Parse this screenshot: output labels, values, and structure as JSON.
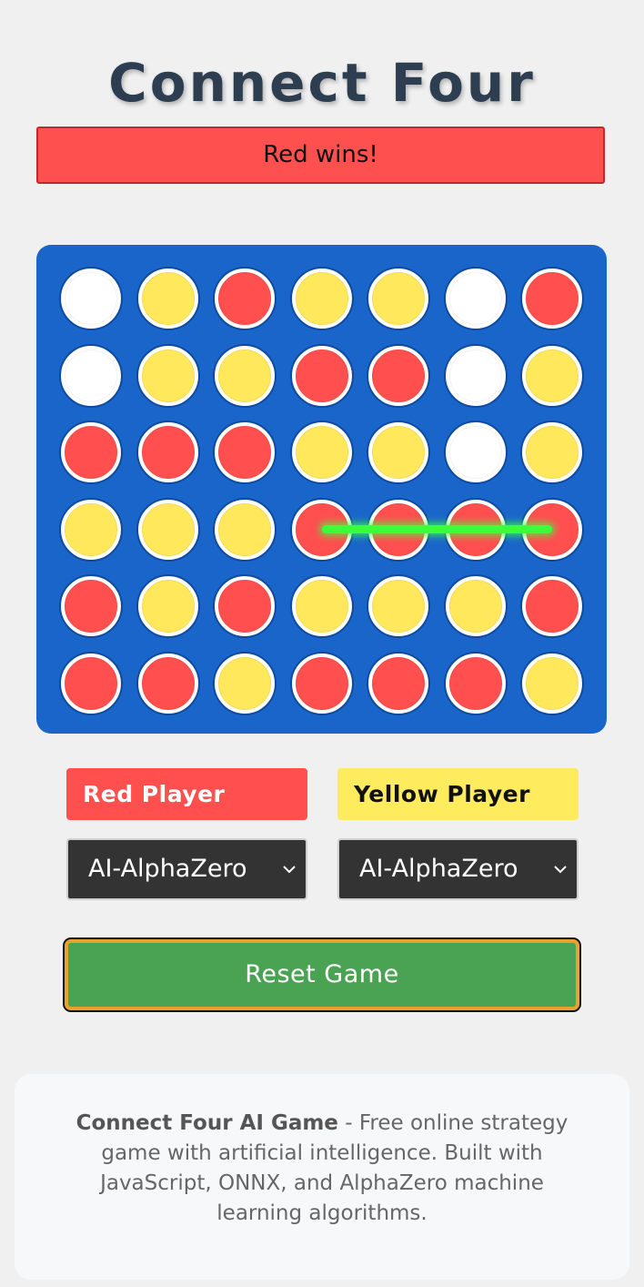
{
  "title": "Connect Four",
  "status": "Red wins!",
  "board": {
    "rows": [
      [
        "empty",
        "yellow",
        "red",
        "yellow",
        "yellow",
        "empty",
        "red"
      ],
      [
        "empty",
        "yellow",
        "yellow",
        "red",
        "red",
        "empty",
        "yellow"
      ],
      [
        "red",
        "red",
        "red",
        "yellow",
        "yellow",
        "empty",
        "yellow"
      ],
      [
        "yellow",
        "yellow",
        "yellow",
        "red",
        "red",
        "red",
        "red"
      ],
      [
        "red",
        "yellow",
        "red",
        "yellow",
        "yellow",
        "yellow",
        "red"
      ],
      [
        "red",
        "red",
        "yellow",
        "red",
        "red",
        "red",
        "yellow"
      ]
    ],
    "winning_line": {
      "row": 3,
      "from_col": 3,
      "to_col": 6,
      "color": "#3cff3c"
    }
  },
  "colors": {
    "board": "#1a65c9",
    "red": "#ff4f4f",
    "yellow": "#ffe85c",
    "empty": "#ffffff",
    "reset_button": "#4aa352"
  },
  "players": {
    "red": {
      "label": "Red Player",
      "selected": "AI-AlphaZero"
    },
    "yellow": {
      "label": "Yellow Player",
      "selected": "AI-AlphaZero"
    }
  },
  "reset_label": "Reset Game",
  "footer": {
    "bold": "Connect Four AI Game",
    "text": " - Free online strategy game with artificial intelligence. Built with JavaScript, ONNX, and AlphaZero machine learning algorithms."
  },
  "icons": {
    "select_arrow": "chevron-down-icon"
  }
}
